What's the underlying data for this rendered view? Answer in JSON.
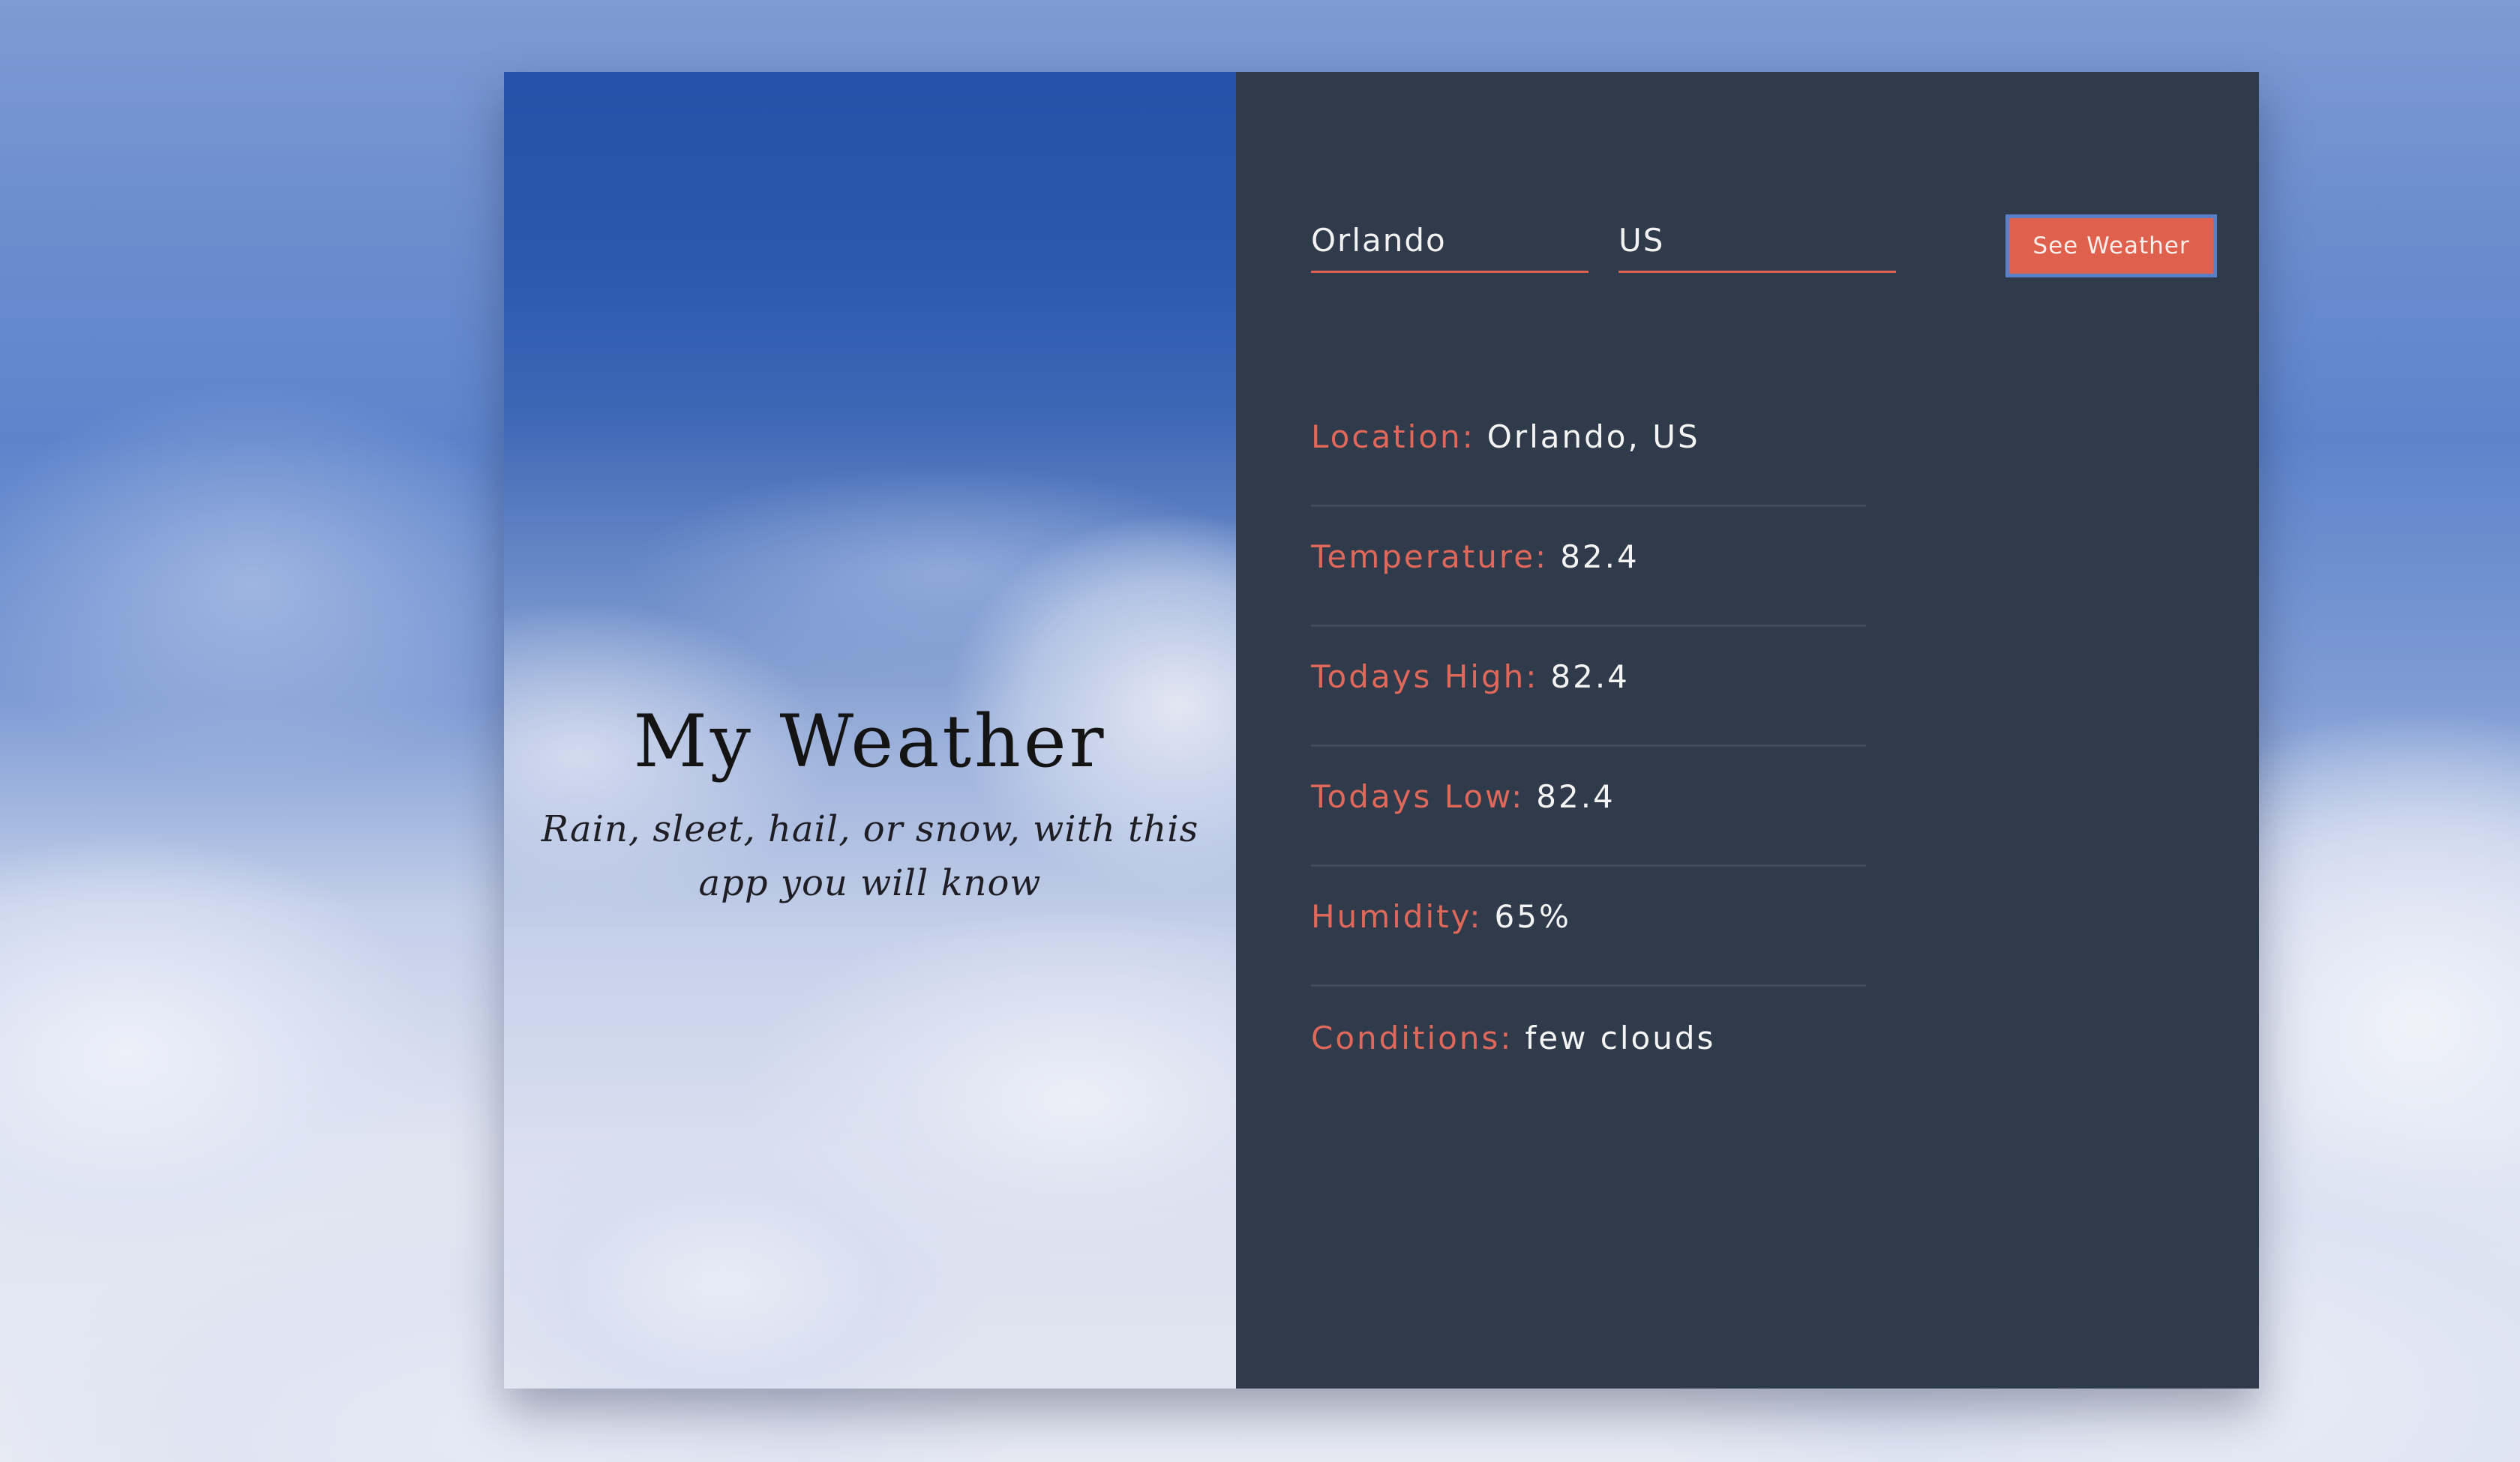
{
  "hero": {
    "title": "My Weather",
    "subtitle": "Rain, sleet, hail, or snow, with this app you will know"
  },
  "search": {
    "city_value": "Orlando",
    "country_value": "US",
    "button_label": "See Weather"
  },
  "details": [
    {
      "label": "Location:",
      "value": "Orlando, US"
    },
    {
      "label": "Temperature:",
      "value": "82.4"
    },
    {
      "label": "Todays High:",
      "value": "82.4"
    },
    {
      "label": "Todays Low:",
      "value": "82.4"
    },
    {
      "label": "Humidity:",
      "value": "65%"
    },
    {
      "label": "Conditions:",
      "value": "few clouds"
    }
  ],
  "colors": {
    "accent": "#e0614f",
    "panel": "#2f3b4b",
    "sky": "#2452aa"
  }
}
